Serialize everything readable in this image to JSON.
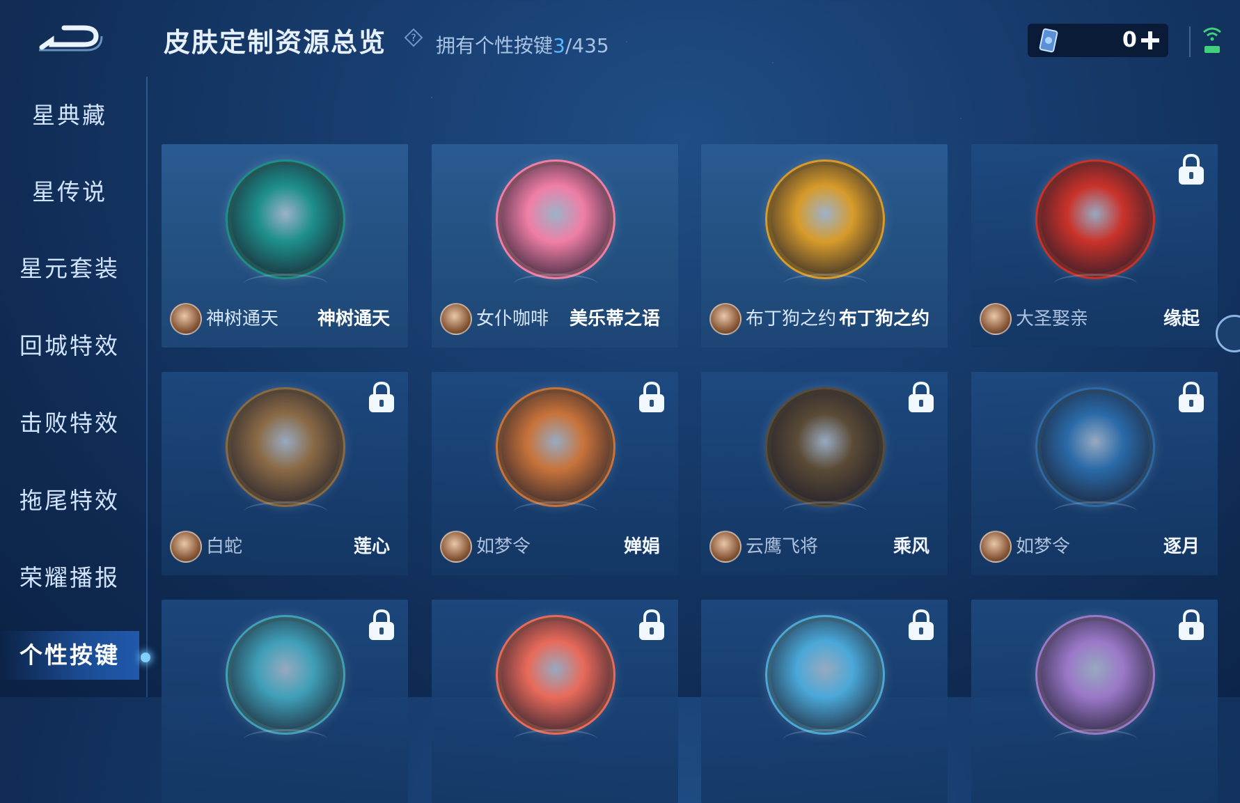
{
  "header": {
    "title": "皮肤定制资源总览",
    "owned_label": "拥有个性按键",
    "owned_count": "3",
    "owned_total": "/435",
    "currency_value": "0"
  },
  "sidebar": {
    "items": [
      {
        "label": "星典藏"
      },
      {
        "label": "星传说"
      },
      {
        "label": "星元套装"
      },
      {
        "label": "回城特效"
      },
      {
        "label": "击败特效"
      },
      {
        "label": "拖尾特效"
      },
      {
        "label": "荣耀播报"
      },
      {
        "label": "个性按键",
        "active": true
      }
    ]
  },
  "grid": {
    "cards": [
      {
        "hero": "神树通天",
        "skin": "神树通天",
        "locked": false,
        "emblem": "teal-gold-tree-emblem",
        "color": "#1d8f8a"
      },
      {
        "hero": "女仆咖啡",
        "skin": "美乐蒂之语",
        "locked": false,
        "emblem": "pink-melody-emblem",
        "color": "#f07ea6"
      },
      {
        "hero": "布丁狗之约",
        "skin": "布丁狗之约",
        "locked": false,
        "emblem": "gold-ribbon-emblem",
        "color": "#d79b2a"
      },
      {
        "hero": "大圣娶亲",
        "skin": "缘起",
        "locked": true,
        "emblem": "red-scroll-emblem",
        "color": "#c9322a"
      },
      {
        "hero": "白蛇",
        "skin": "莲心",
        "locked": true,
        "emblem": "lotus-emblem",
        "color": "#8a6a45"
      },
      {
        "hero": "如梦令",
        "skin": "婵娟",
        "locked": true,
        "emblem": "moon-orb-emblem",
        "color": "#c8733a"
      },
      {
        "hero": "云鹰飞将",
        "skin": "乘风",
        "locked": true,
        "emblem": "spear-emblem",
        "color": "#5a4a36"
      },
      {
        "hero": "如梦令",
        "skin": "逐月",
        "locked": true,
        "emblem": "wing-bow-emblem",
        "color": "#2a6aa8"
      },
      {
        "hero": "",
        "skin": "",
        "locked": true,
        "emblem": "camera-star-emblem",
        "color": "#3fa0b8"
      },
      {
        "hero": "",
        "skin": "",
        "locked": true,
        "emblem": "comic-burst-emblem",
        "color": "#e86a5a"
      },
      {
        "hero": "",
        "skin": "",
        "locked": true,
        "emblem": "pochacco-emblem",
        "color": "#4aa8d8"
      },
      {
        "hero": "",
        "skin": "",
        "locked": true,
        "emblem": "kuromi-emblem",
        "color": "#9a78c8"
      }
    ]
  }
}
